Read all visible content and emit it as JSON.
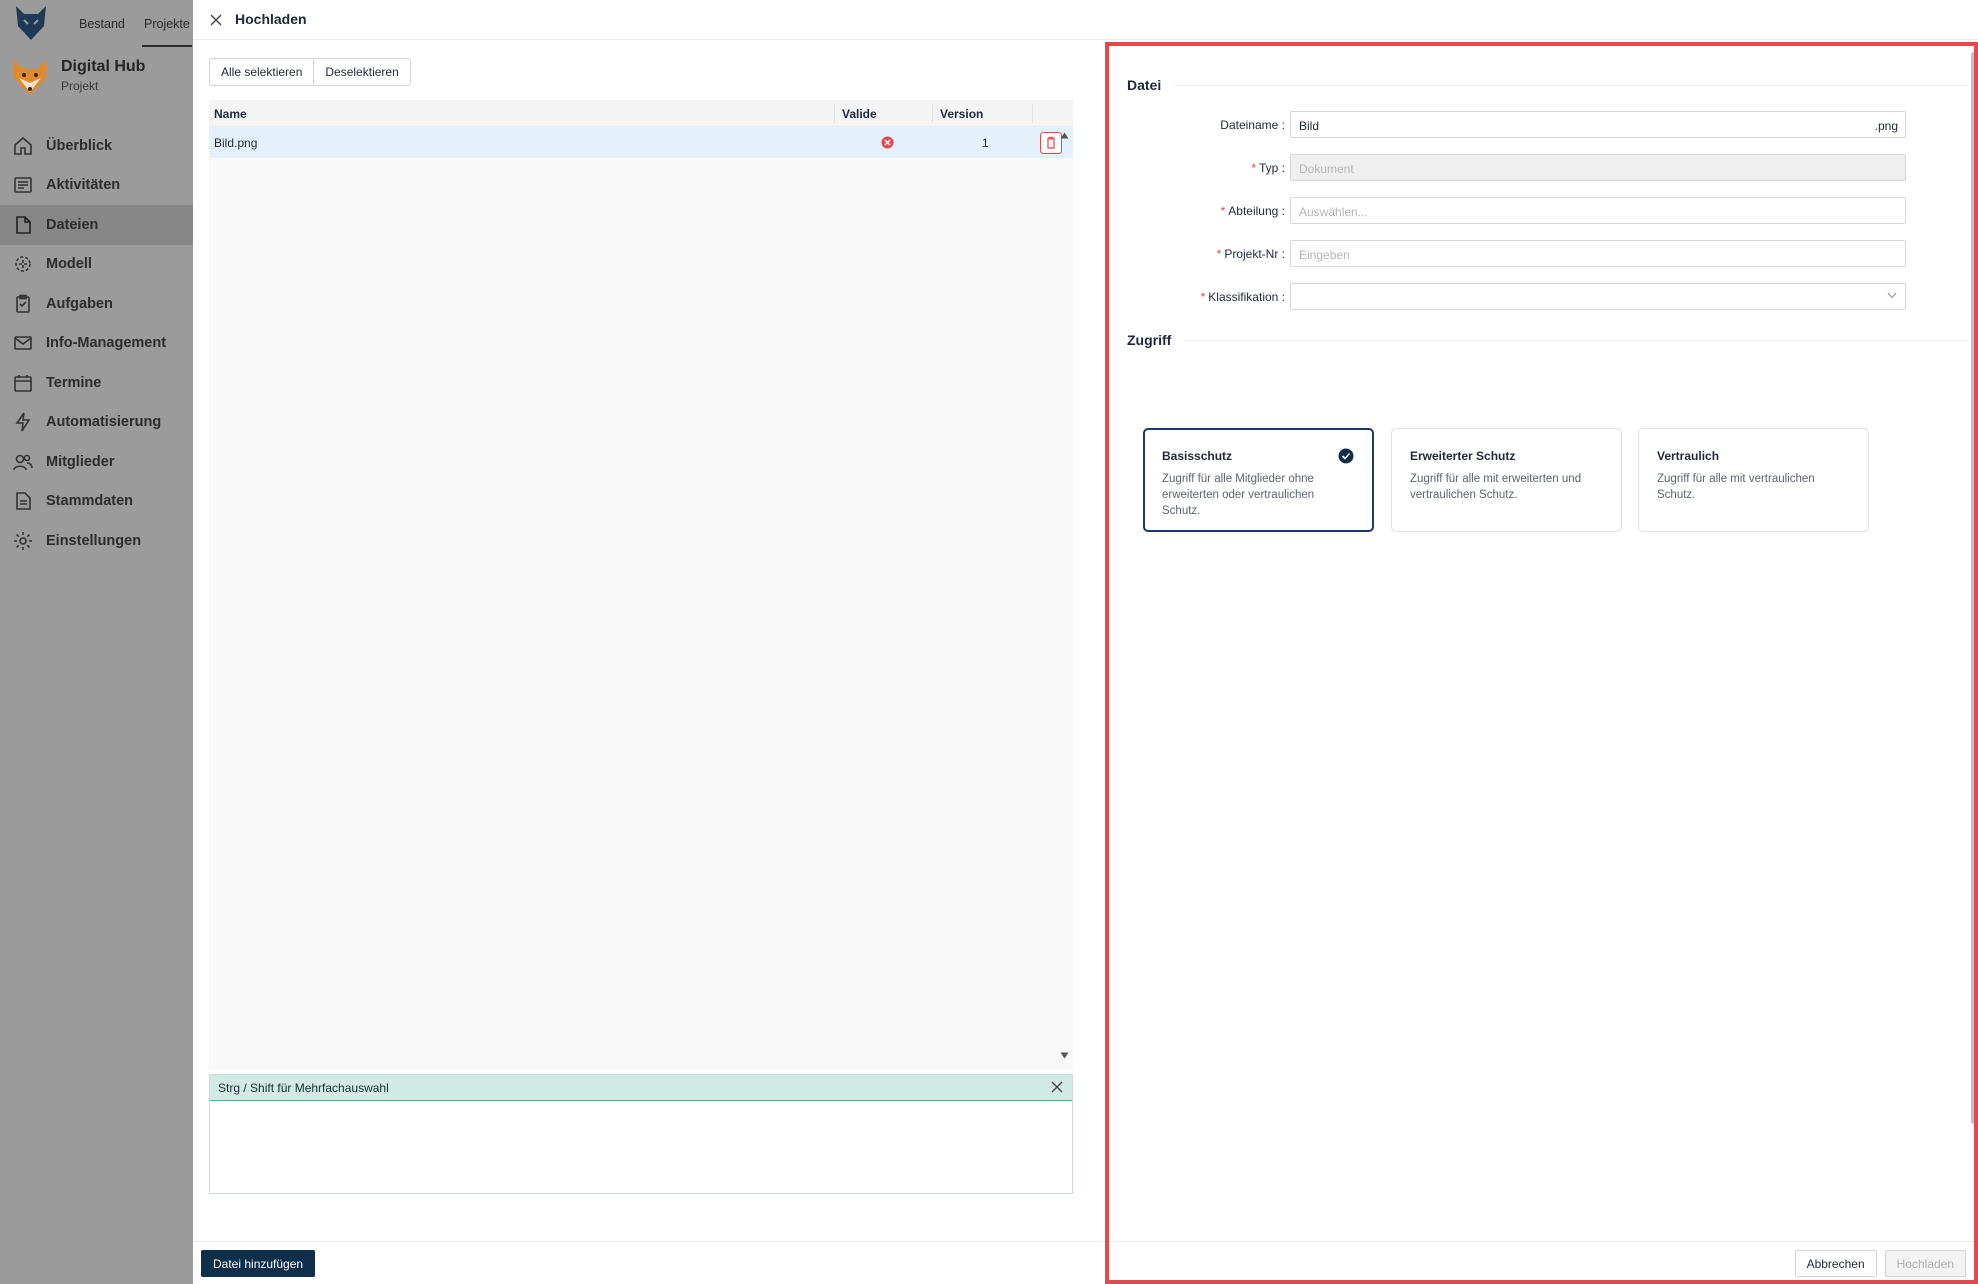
{
  "topbar": {
    "tab_bestand": "Bestand",
    "tab_projekte": "Projekte"
  },
  "project": {
    "title": "Digital Hub",
    "subtitle": "Projekt"
  },
  "nav": {
    "items": [
      {
        "label": "Überblick",
        "icon": "home-icon"
      },
      {
        "label": "Aktivitäten",
        "icon": "activity-icon"
      },
      {
        "label": "Dateien",
        "icon": "file-icon",
        "active": true
      },
      {
        "label": "Modell",
        "icon": "model-icon"
      },
      {
        "label": "Aufgaben",
        "icon": "clipboard-icon"
      },
      {
        "label": "Info-Management",
        "icon": "mail-icon"
      },
      {
        "label": "Termine",
        "icon": "calendar-icon"
      },
      {
        "label": "Automatisierung",
        "icon": "lightning-icon"
      },
      {
        "label": "Mitglieder",
        "icon": "users-icon"
      },
      {
        "label": "Stammdaten",
        "icon": "document-icon"
      },
      {
        "label": "Einstellungen",
        "icon": "gear-icon"
      }
    ]
  },
  "modal": {
    "title": "Hochladen"
  },
  "selection": {
    "select_all": "Alle selektieren",
    "deselect": "Deselektieren"
  },
  "table": {
    "columns": {
      "name": "Name",
      "valid": "Valide",
      "version": "Version"
    },
    "rows": [
      {
        "name": "Bild.png",
        "valid": false,
        "version": "1"
      }
    ]
  },
  "hint": {
    "text": "Strg / Shift für Mehrfachauswahl"
  },
  "add_file_button": "Datei hinzufügen",
  "form": {
    "section_file": "Datei",
    "filename_label": "Dateiname",
    "filename_value": "Bild",
    "filename_suffix": ".png",
    "type_label": "Typ",
    "type_placeholder": "Dokument",
    "department_label": "Abteilung",
    "department_placeholder": "Auswählen...",
    "project_no_label": "Projekt-Nr",
    "project_no_placeholder": "Eingeben",
    "classification_label": "Klassifikation",
    "section_access": "Zugriff"
  },
  "access": {
    "options": [
      {
        "title": "Basisschutz",
        "desc": "Zugriff für alle Mitglieder ohne erweiterten oder vertraulichen Schutz.",
        "selected": true
      },
      {
        "title": "Erweiterter Schutz",
        "desc": "Zugriff für alle mit erweiterten und vertraulichen Schutz.",
        "selected": false
      },
      {
        "title": "Vertraulich",
        "desc": "Zugriff für alle mit vertraulichen Schutz.",
        "selected": false
      }
    ]
  },
  "footer": {
    "cancel": "Abbrechen",
    "upload": "Hochladen"
  },
  "colors": {
    "primary": "#0f2e4a",
    "selected_border": "#1b3a6b",
    "error": "#e5484d",
    "row_selected": "#e4f1fb",
    "hint_bg": "#d0eae4"
  }
}
